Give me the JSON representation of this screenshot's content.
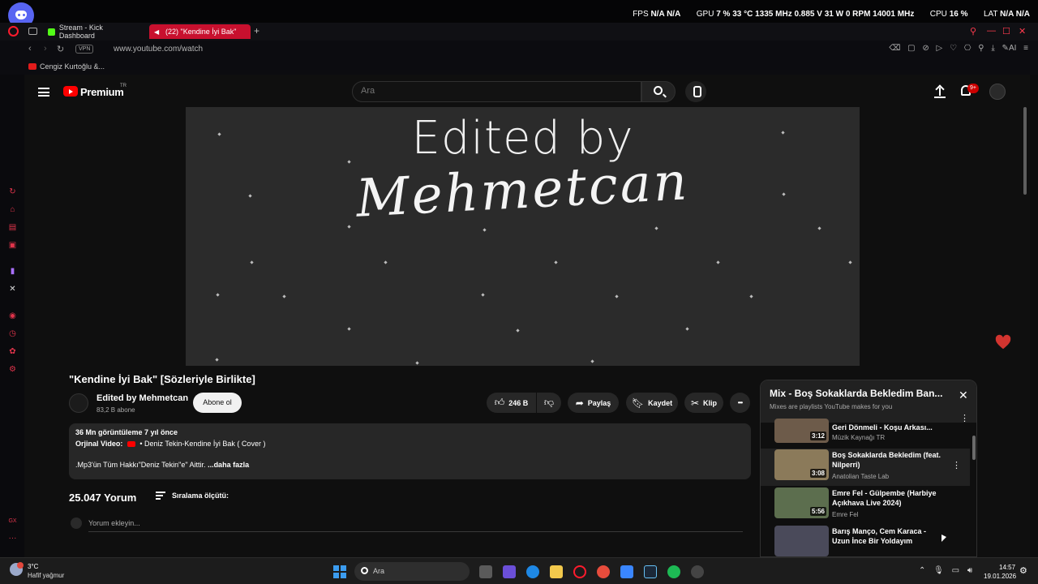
{
  "hud": {
    "fps_label": "FPS",
    "fps_values": "N/A  N/A",
    "gpu_label": "GPU",
    "gpu_values": "7 %  33 °C  1335 MHz  0.885 V  31 W  0 RPM  14001 MHz",
    "cpu_label": "CPU",
    "cpu_values": "16 %",
    "lat_label": "LAT",
    "lat_values": "N/A  N/A"
  },
  "browser": {
    "tabs": [
      {
        "label": "Stream - Kick Dashboard",
        "color": "#53fc18"
      },
      {
        "label": "(22) \"Kendine İyi Bak\"",
        "color": "#ffffff"
      }
    ],
    "new_tab": "+",
    "vpn_label": "VPN",
    "url": "www.youtube.com/watch",
    "ext_icons": "⌫ ▢ ⊘ ▷ ♡ ⎔ ⚲ ⤓ ✎AI ≡",
    "bookmark": "Cengiz Kurtoğlu &..."
  },
  "youtube": {
    "logo_text": "Premium",
    "logo_region": "TR",
    "search_placeholder": "Ara",
    "notification_count": "9+",
    "player": {
      "line1": "Edited by",
      "line2": "Mehmetcan"
    },
    "video_title": "\"Kendine İyi Bak\" [Sözleriyle Birlikte]",
    "channel_name": "Edited by Mehmetcan",
    "channel_subs": "83,2 B abone",
    "subscribe_label": "Abone ol",
    "like_count": "246 B",
    "share_label": "Paylaş",
    "save_label": "Kaydet",
    "clip_label": "Klip",
    "more_label": "•••",
    "description": {
      "stats": "36 Mn görüntüleme  7 yıl önce",
      "original_label": "Orjinal Video:",
      "original_link": "• Deniz Tekin-Kendine İyi Bak ( Cover )",
      "rights_text": ".Mp3'ün Tüm Hakkı\"Deniz Tekin\"e\" Aittir.",
      "more": "...daha fazla"
    },
    "comments_count": "25.047 Yorum",
    "sort_label": "Sıralama ölçütü:",
    "add_comment_placeholder": "Yorum ekleyin...",
    "mix": {
      "title": "Mix - Boş Sokaklarda Bekledim Ban...",
      "subtitle": "Mixes are playlists YouTube makes for you",
      "items": [
        {
          "title": "Geri Dönmeli - Koşu Arkası...",
          "artist": "Müzik Kaynağı TR",
          "duration": "3:12"
        },
        {
          "title": "Boş Sokaklarda Bekledim (feat. Nilperri)",
          "artist": "Anatolian Taste Lab",
          "duration": "3:08"
        },
        {
          "title": "Emre Fel - Gülpembe (Harbiye Açıkhava Live 2024)",
          "artist": "Emre Fel",
          "duration": "5:56"
        },
        {
          "title": "Barış Manço, Cem Karaca - Uzun İnce Bir Yoldayım",
          "artist": "",
          "duration": ""
        }
      ]
    }
  },
  "taskbar": {
    "temperature": "3°C",
    "weather": "Hafif yağmur",
    "search_label": "Ara",
    "time": "14:57",
    "date": "19.01.2026"
  }
}
